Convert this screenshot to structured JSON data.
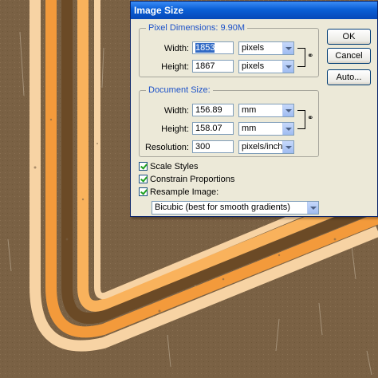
{
  "dialog": {
    "title": "Image Size",
    "buttons": {
      "ok": "OK",
      "cancel": "Cancel",
      "auto": "Auto..."
    },
    "pixel_dimensions": {
      "legend": "Pixel Dimensions:  9.90M",
      "width_label": "Width:",
      "width_value": "1853",
      "width_unit": "pixels",
      "height_label": "Height:",
      "height_value": "1867",
      "height_unit": "pixels"
    },
    "document_size": {
      "legend": "Document Size:",
      "width_label": "Width:",
      "width_value": "156.89",
      "width_unit": "mm",
      "height_label": "Height:",
      "height_value": "158.07",
      "height_unit": "mm",
      "resolution_label": "Resolution:",
      "resolution_value": "300",
      "resolution_unit": "pixels/inch"
    },
    "options": {
      "scale_styles": "Scale Styles",
      "constrain_proportions": "Constrain Proportions",
      "resample_image": "Resample Image:",
      "resample_method": "Bicubic (best for smooth gradients)"
    }
  },
  "colors": {
    "background": "#7d6446",
    "stripe_cream": "#f7d3a4",
    "stripe_orange": "#f39a3b",
    "stripe_brown": "#6b4a26",
    "stripe_light_orange": "#f9b25c"
  }
}
